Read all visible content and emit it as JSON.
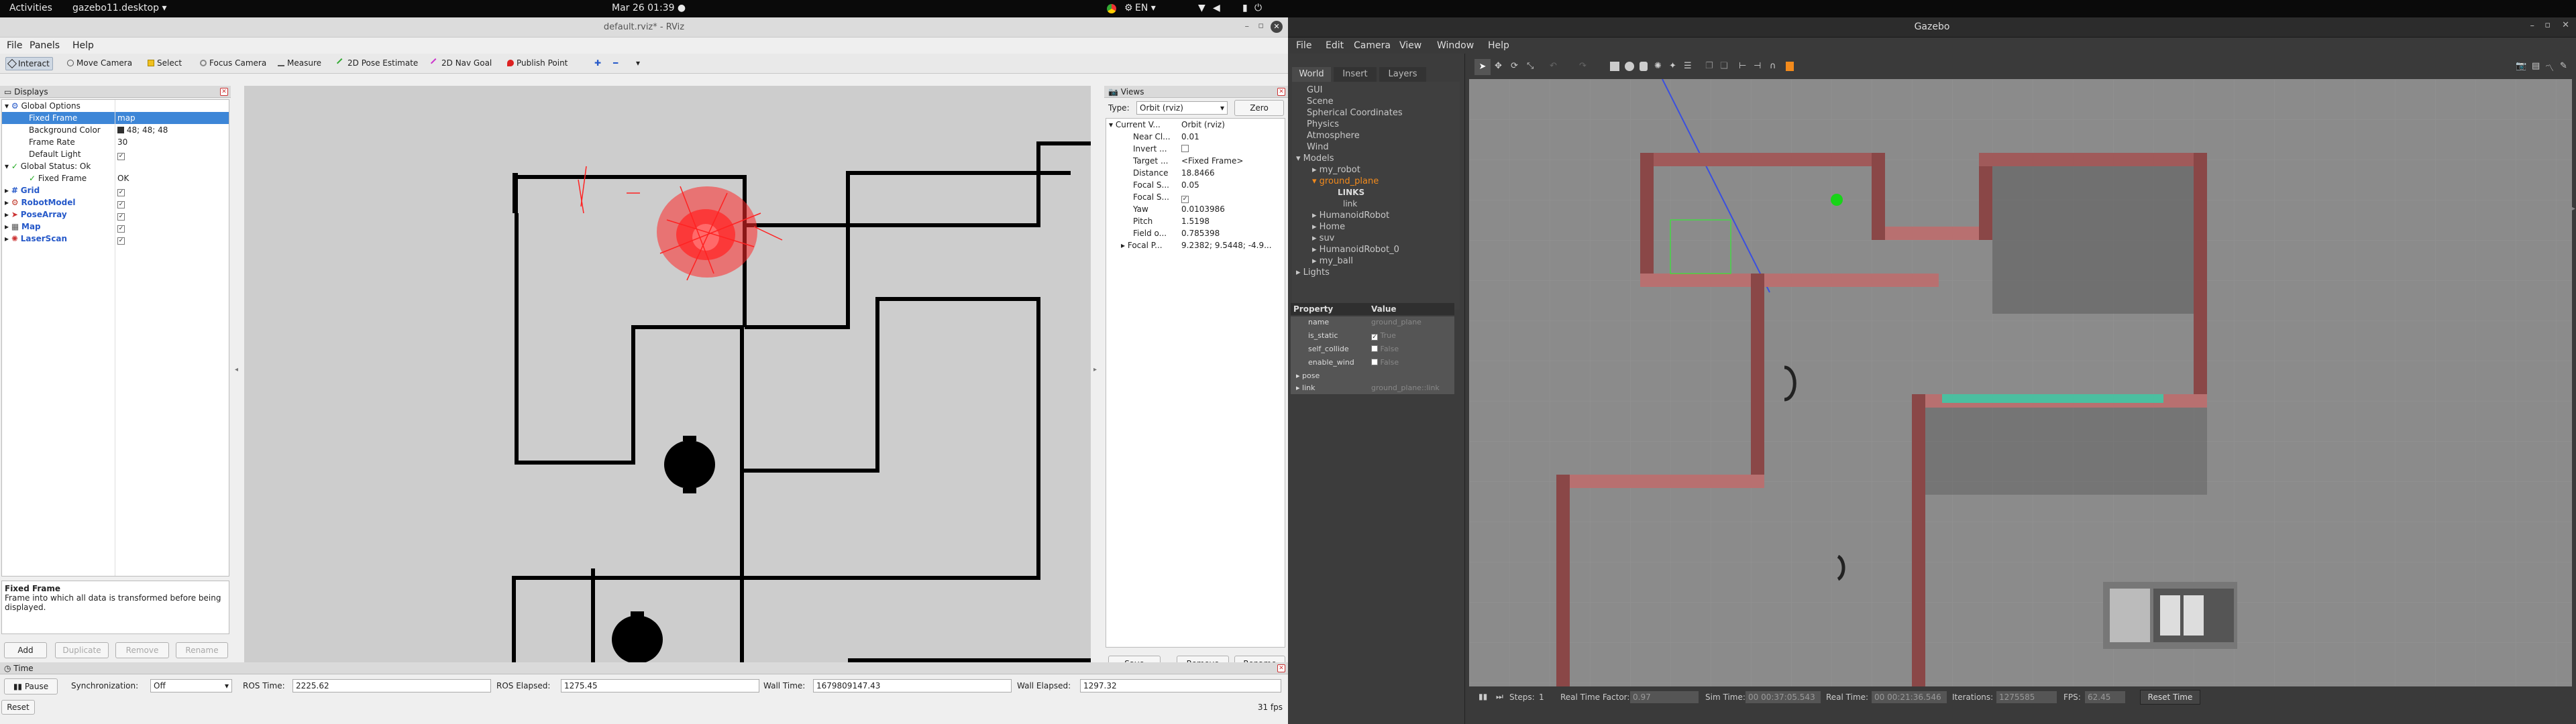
{
  "topbar": {
    "activities": "Activities",
    "app_menu": "gazebo11.desktop ▾",
    "clock": "Mar 26  01:39  ●",
    "lang": "EN ▾"
  },
  "rviz": {
    "title": "default.rviz* - RViz",
    "menu": [
      "File",
      "Panels",
      "Help"
    ],
    "tools": [
      "Interact",
      "Move Camera",
      "Select",
      "Focus Camera",
      "Measure",
      "2D Pose Estimate",
      "2D Nav Goal",
      "Publish Point"
    ],
    "displays": {
      "header": "Displays",
      "rows": [
        {
          "k": "Global Options",
          "v": ""
        },
        {
          "k": "Fixed Frame",
          "v": "map"
        },
        {
          "k": "Background Color",
          "v": "48; 48; 48"
        },
        {
          "k": "Frame Rate",
          "v": "30"
        },
        {
          "k": "Default Light",
          "v": "✓"
        },
        {
          "k": "Global Status: Ok",
          "v": ""
        },
        {
          "k": "Fixed Frame",
          "v": "OK"
        },
        {
          "k": "Grid",
          "v": "✓"
        },
        {
          "k": "RobotModel",
          "v": "✓"
        },
        {
          "k": "PoseArray",
          "v": "✓"
        },
        {
          "k": "Map",
          "v": "✓"
        },
        {
          "k": "LaserScan",
          "v": "✓"
        }
      ],
      "help_title": "Fixed Frame",
      "help_text": "Frame into which all data is transformed before being displayed.",
      "buttons": [
        "Add",
        "Duplicate",
        "Remove",
        "Rename"
      ]
    },
    "views": {
      "header": "Views",
      "type_label": "Type:",
      "type_value": "Orbit (rviz)",
      "zero": "Zero",
      "rows": [
        {
          "k": "Current V...",
          "v": "Orbit (rviz)"
        },
        {
          "k": "Near Cl...",
          "v": "0.01"
        },
        {
          "k": "Invert ...",
          "v": ""
        },
        {
          "k": "Target ...",
          "v": "<Fixed Frame>"
        },
        {
          "k": "Distance",
          "v": "18.8466"
        },
        {
          "k": "Focal S...",
          "v": "0.05"
        },
        {
          "k": "Focal S...",
          "v": "✓"
        },
        {
          "k": "Yaw",
          "v": "0.0103986"
        },
        {
          "k": "Pitch",
          "v": "1.5198"
        },
        {
          "k": "Field o...",
          "v": "0.785398"
        },
        {
          "k": "Focal P...",
          "v": "9.2382; 9.5448; -4.9..."
        }
      ],
      "buttons": [
        "Save",
        "Remove",
        "Rename"
      ]
    },
    "time": {
      "header": "Time",
      "pause": "Pause",
      "sync_label": "Synchronization:",
      "sync_value": "Off",
      "ros_time_label": "ROS Time:",
      "ros_time": "2225.62",
      "ros_elapsed_label": "ROS Elapsed:",
      "ros_elapsed": "1275.45",
      "wall_time_label": "Wall Time:",
      "wall_time": "1679809147.43",
      "wall_elapsed_label": "Wall Elapsed:",
      "wall_elapsed": "1297.32",
      "reset": "Reset",
      "fps": "31 fps"
    }
  },
  "gazebo": {
    "title": "Gazebo",
    "menu": [
      "File",
      "Edit",
      "Camera",
      "View",
      "Window",
      "Help"
    ],
    "tabs": [
      "World",
      "Insert",
      "Layers"
    ],
    "tree": [
      "GUI",
      "Scene",
      "Spherical Coordinates",
      "Physics",
      "Atmosphere",
      "Wind",
      "Models",
      "my_robot",
      "ground_plane",
      "LINKS",
      "link",
      "HumanoidRobot",
      "Home",
      "suv",
      "HumanoidRobot_0",
      "my_ball",
      "Lights"
    ],
    "prop_header": [
      "Property",
      "Value"
    ],
    "props": [
      {
        "k": "name",
        "v": "ground_plane"
      },
      {
        "k": "is_static",
        "v": "True"
      },
      {
        "k": "self_collide",
        "v": "False"
      },
      {
        "k": "enable_wind",
        "v": "False"
      },
      {
        "k": "pose",
        "v": ""
      },
      {
        "k": "link",
        "v": "ground_plane::link"
      }
    ],
    "status": {
      "steps_label": "Steps:",
      "steps": "1",
      "rtf_label": "Real Time Factor:",
      "rtf": "0.97",
      "sim_label": "Sim Time:",
      "sim": "00 00:37:05.543",
      "real_label": "Real Time:",
      "real": "00 00:21:36.546",
      "iter_label": "Iterations:",
      "iter": "1275585",
      "fps_label": "FPS:",
      "fps": "62.45",
      "reset": "Reset Time"
    }
  }
}
